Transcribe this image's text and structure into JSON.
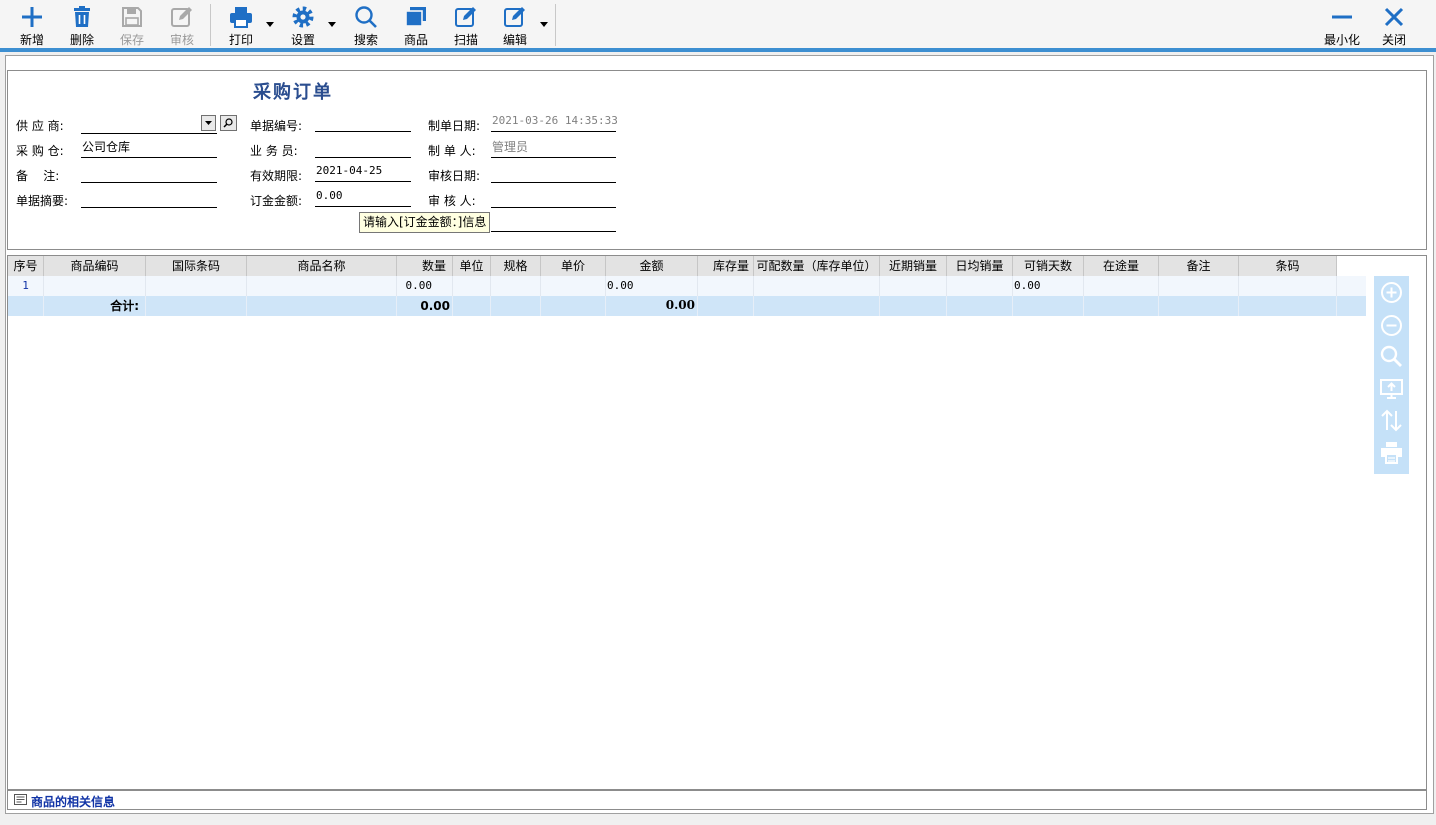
{
  "toolbar": {
    "items": [
      {
        "label": "新增",
        "icon": "plus-icon",
        "enabled": true
      },
      {
        "label": "删除",
        "icon": "trash-icon",
        "enabled": true
      },
      {
        "label": "保存",
        "icon": "save-icon",
        "enabled": false
      },
      {
        "label": "审核",
        "icon": "audit-edit-icon",
        "enabled": false
      },
      {
        "label": "打印",
        "icon": "printer-icon",
        "enabled": true
      },
      {
        "label": "设置",
        "icon": "gear-icon",
        "enabled": true
      },
      {
        "label": "搜索",
        "icon": "search-icon",
        "enabled": true
      },
      {
        "label": "商品",
        "icon": "product-icon",
        "enabled": true
      },
      {
        "label": "扫描",
        "icon": "scan-edit-icon",
        "enabled": true
      },
      {
        "label": "编辑",
        "icon": "edit-icon",
        "enabled": true
      }
    ],
    "window": {
      "minimize_label": "最小化",
      "close_label": "关闭"
    },
    "accent_color": "#1f6fc5"
  },
  "form": {
    "title": "采购订单",
    "supplier": {
      "label": "供 应 商:",
      "value": ""
    },
    "warehouse": {
      "label": "采 购 仓:",
      "value": "公司仓库"
    },
    "remark": {
      "label": "备    注:",
      "value": ""
    },
    "summary": {
      "label": "单据摘要:",
      "value": ""
    },
    "doc_no": {
      "label": "单据编号:",
      "value": ""
    },
    "salesman": {
      "label": "业 务 员:",
      "value": ""
    },
    "valid_until": {
      "label": "有效期限:",
      "value": "2021-04-25"
    },
    "deposit": {
      "label": "订金金额:",
      "value": "0.00"
    },
    "created_date": {
      "label": "制单日期:",
      "value": "2021-03-26 14:35:33"
    },
    "creator": {
      "label": "制 单 人:",
      "value": "管理员"
    },
    "audit_date": {
      "label": "审核日期:",
      "value": ""
    },
    "auditor": {
      "label": "审 核 人:",
      "value": ""
    },
    "tooltip": "请输入[订金金额：]信息"
  },
  "grid": {
    "columns": [
      "序号",
      "商品编码",
      "国际条码",
      "商品名称",
      "数量",
      "单位",
      "规格",
      "单价",
      "金额",
      "库存量",
      "可配数量（库存单位）",
      "近期销量",
      "日均销量",
      "可销天数",
      "在途量",
      "备注",
      "条码"
    ],
    "rows": [
      {
        "no": "1",
        "qty": "0.00",
        "amount": "0.00",
        "days": "0.00"
      }
    ],
    "total": {
      "label": "合计:",
      "qty": "0.00",
      "amount": "0.00"
    }
  },
  "side_tools": [
    "zoom-in-icon",
    "zoom-out-icon",
    "search-icon",
    "screen-icon",
    "sort-icon",
    "printer-icon"
  ],
  "footer": {
    "label": "商品的相关信息"
  }
}
